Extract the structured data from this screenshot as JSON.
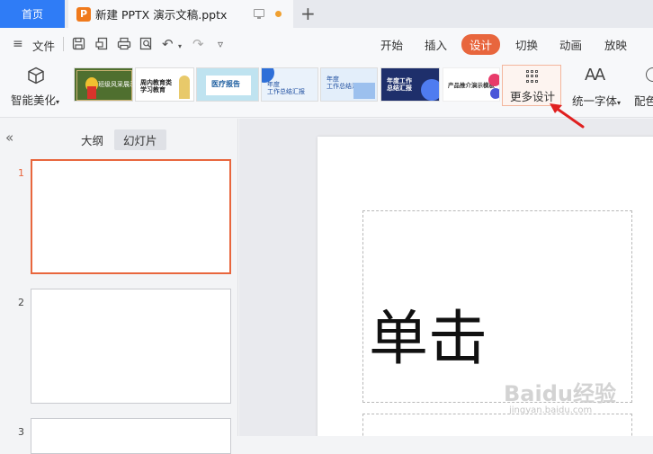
{
  "titlebar": {
    "home_tab": "首页",
    "doc_icon_letter": "P",
    "doc_title": "新建 PPTX 演示文稿.pptx",
    "new_tab": "+"
  },
  "menubar": {
    "menu_icon": "≡",
    "file_label": "文件",
    "undo_icon": "↶",
    "redo_icon": "↷",
    "more_icon": "▿",
    "tabs": [
      "开始",
      "插入",
      "设计",
      "切换",
      "动画",
      "放映"
    ],
    "active_tab": "设计"
  },
  "ribbon": {
    "beautify_label": "智能美化",
    "beautify_dropdown": "▾",
    "thumbs": [
      {
        "text": "班级风采展示会",
        "bg": "#4f6f2f"
      },
      {
        "text": "周内教育类\n学习教育",
        "bg": "#ffffff"
      },
      {
        "text": "医疗报告",
        "bg": "#bfe3f0"
      },
      {
        "text": "年度\n工作总结汇报",
        "bg": "#eaf2fb"
      },
      {
        "text": "年度\n工作总结汇报",
        "bg": "#e3eefa"
      },
      {
        "text": "年度工作\n总结汇报",
        "bg": "#1e2f6b"
      },
      {
        "text": "产品推介演示模板",
        "bg": "#ffffff"
      }
    ],
    "more_design_label": "更多设计",
    "font_icon_text": "AA",
    "unify_font_label": "统一字体",
    "unify_font_dropdown": "▾",
    "color_label": "配色"
  },
  "panel": {
    "collapse_icon": "«",
    "tab_outline": "大纲",
    "tab_slides": "幻灯片",
    "slides": [
      "1",
      "2",
      "3"
    ]
  },
  "canvas": {
    "title_text": "单击",
    "watermark": "Baidu经验",
    "watermark_sub": "jingyan.baidu.com"
  },
  "colors": {
    "accent": "#e8663d",
    "home_tab": "#2f7cf6",
    "annotation": "#e02020"
  }
}
